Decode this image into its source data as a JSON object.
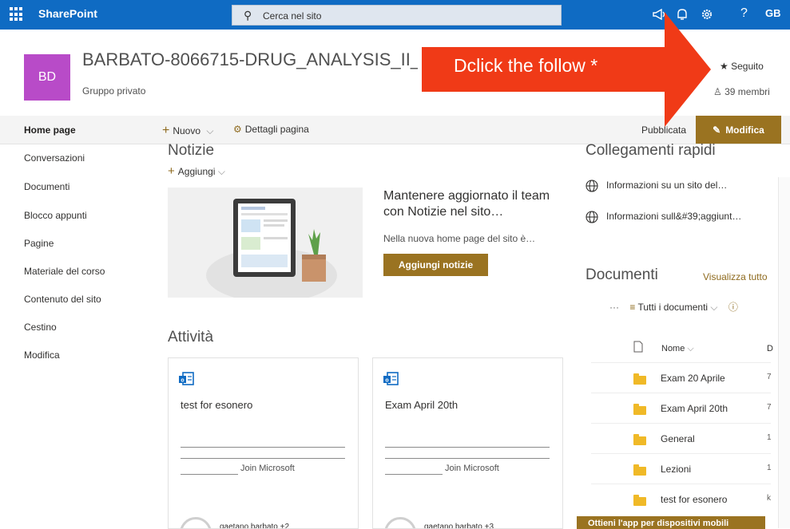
{
  "suitebar": {
    "app_name": "SharePoint",
    "search_placeholder": "Cerca nel sito",
    "help_glyph": "?",
    "user_initials": "GB",
    "icons": [
      "waffle-icon",
      "megaphone-icon",
      "bell-icon",
      "gear-icon",
      "help-icon"
    ],
    "bar_color": "#0f6bc3"
  },
  "site": {
    "logo_initials": "BD",
    "logo_color": "#b84bc8",
    "title": "BARBATO-8066715-DRUG_ANALYSIS_II_",
    "privacy": "Gruppo privato",
    "follow_label": "Seguito",
    "members_label": "39 membri"
  },
  "annotation": {
    "text": "Dclick the follow *",
    "color": "#f03a17"
  },
  "commandbar": {
    "home": "Home page",
    "new_label": "Nuovo",
    "details_label": "Dettagli pagina",
    "status": "Pubblicata",
    "edit_label": "Modifica",
    "accent": "#9a7321"
  },
  "nav": {
    "items": [
      {
        "label": "Conversazioni"
      },
      {
        "label": "Documenti"
      },
      {
        "label": "Blocco appunti"
      },
      {
        "label": "Pagine"
      },
      {
        "label": "Materiale del corso"
      },
      {
        "label": "Contenuto del sito"
      },
      {
        "label": "Cestino"
      },
      {
        "label": "Modifica"
      }
    ]
  },
  "news": {
    "title": "Notizie",
    "add_label": "Aggiungi",
    "headline": "Mantenere aggiornato il team con Notizie nel sito…",
    "subtext": "Nella nuova home page del sito è…",
    "button": "Aggiungi notizie"
  },
  "activity": {
    "title": "Attività",
    "cards": [
      {
        "title": "test for esonero",
        "join": "Join Microsoft",
        "footer": "gaetano barbato +2"
      },
      {
        "title": "Exam April 20th",
        "join": "Join Microsoft",
        "footer": "gaetano barbato +3"
      }
    ]
  },
  "quicklinks": {
    "title": "Collegamenti rapidi",
    "items": [
      {
        "label": "Informazioni su un sito del…"
      },
      {
        "label": "Informazioni sull&#39;aggiunt…"
      }
    ]
  },
  "documents": {
    "title": "Documenti",
    "view_all": "Visualizza tutto",
    "more": "···",
    "view_name": "Tutti i documenti",
    "column_name": "Nome",
    "column_next": "D",
    "rows": [
      {
        "name": "Exam 20 Aprile",
        "value": "7"
      },
      {
        "name": "Exam April 20th",
        "value": "7"
      },
      {
        "name": "General",
        "value": "1"
      },
      {
        "name": "Lezioni",
        "value": "1"
      },
      {
        "name": "test for esonero",
        "value": "k"
      }
    ],
    "app_banner": "Ottieni l'app per dispositivi mobili"
  }
}
